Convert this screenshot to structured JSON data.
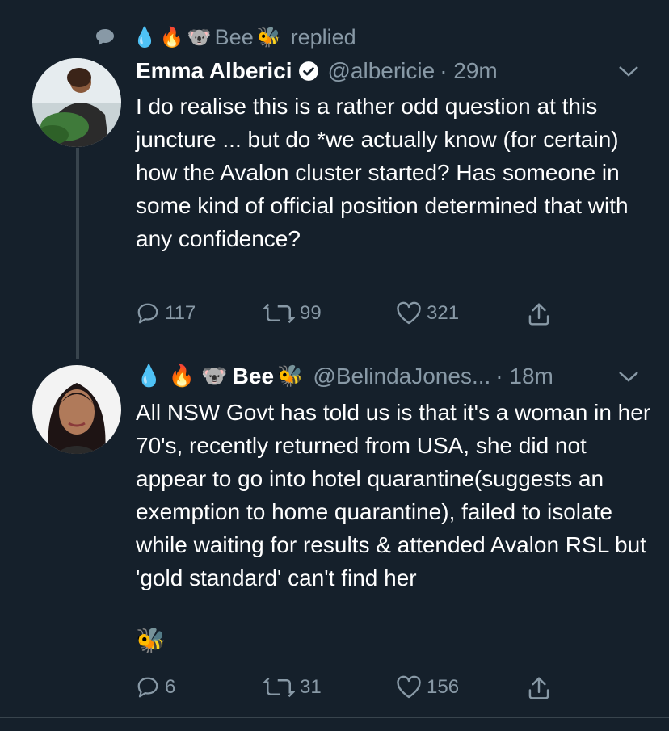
{
  "reply_context": {
    "emojis": [
      "💧",
      "🔥",
      "🐨"
    ],
    "name": "Bee",
    "bee_emoji": "🐝",
    "action": "replied",
    "icon": "speech-bubble-icon"
  },
  "tweets": [
    {
      "name": "Emma Alberici",
      "verified": true,
      "handle": "@albericie",
      "time": "· 29m",
      "text": "I do realise this is a rather odd question at this juncture ... but do *we actually know (for certain) how the Avalon cluster started? Has someone in some kind of official position determined that with any confidence?",
      "replies": "117",
      "retweets": "99",
      "likes": "321"
    },
    {
      "name_prefix_emojis": "💧 🔥 🐨",
      "name": "Bee",
      "name_suffix_emoji": "🐝",
      "handle": "@BelindaJones...",
      "time": "· 18m",
      "text": "All NSW Govt has told us is that it's a woman in her 70's, recently returned from USA, she did not appear to go into hotel quarantine(suggests an exemption to home quarantine), failed to isolate while waiting for results & attended Avalon RSL but 'gold standard' can't find her",
      "trailing_emoji": "🐝",
      "replies": "6",
      "retweets": "31",
      "likes": "156"
    }
  ],
  "icons": {
    "caret": "chevron-down-icon",
    "reply": "reply-icon",
    "retweet": "retweet-icon",
    "like": "heart-icon",
    "share": "share-icon",
    "verified": "verified-badge-icon"
  },
  "colors": {
    "background": "#15202b",
    "text": "#ffffff",
    "secondary": "#8899a6",
    "divider": "#38444d"
  }
}
